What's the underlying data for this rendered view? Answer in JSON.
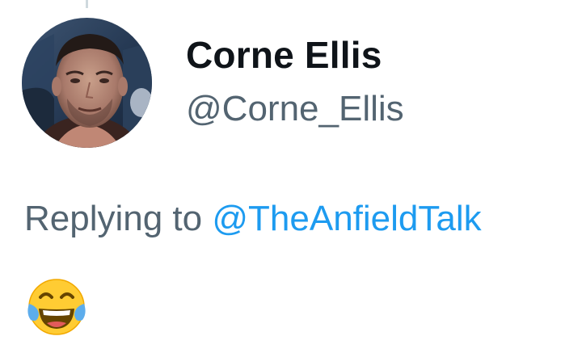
{
  "tweet": {
    "author": {
      "display_name": "Corne Ellis",
      "handle": "@Corne_Ellis",
      "avatar_icon": "profile-photo"
    },
    "reply": {
      "prefix": "Replying to ",
      "mention": "@TheAnfieldTalk"
    },
    "text": "😂",
    "text_icon": "face-with-tears-of-joy-emoji"
  },
  "colors": {
    "primary_text": "#0f1419",
    "secondary_text": "#536471",
    "mention": "#1d9bf0",
    "thread_line": "#cfd9de"
  }
}
